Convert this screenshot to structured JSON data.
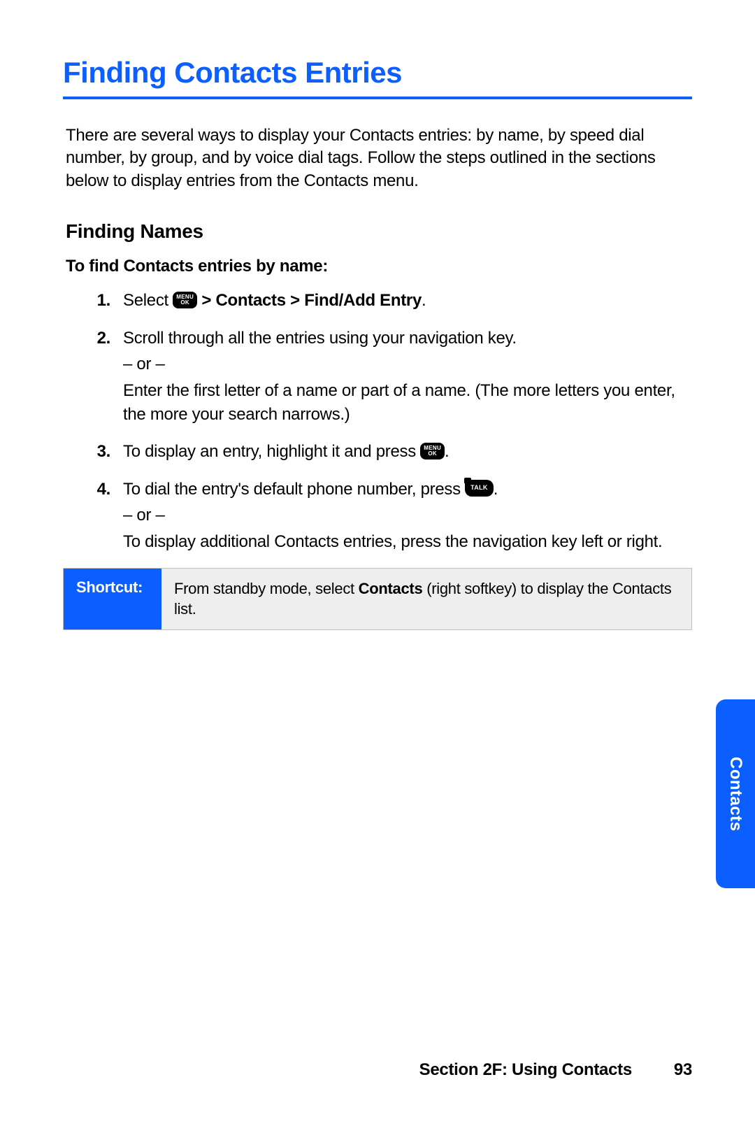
{
  "title": "Finding Contacts Entries",
  "intro": "There are several ways to display your Contacts entries: by name, by speed dial number, by group, and by voice dial tags. Follow the steps outlined in the sections below to display entries from the Contacts menu.",
  "subhead": "Finding Names",
  "lead": "To find Contacts entries by name:",
  "keys": {
    "menu_l1": "MENU",
    "menu_l2": "OK",
    "talk": "TALK"
  },
  "steps": {
    "n1": "1.",
    "s1a": "Select ",
    "s1b": " > Contacts > Find/Add Entry",
    "s1c": ".",
    "n2": "2.",
    "s2a": "Scroll through all the entries using your navigation key.",
    "s2or": "– or –",
    "s2b": "Enter the first letter of a name or part of a name. (The more letters you enter, the more your search narrows.)",
    "n3": "3.",
    "s3a": "To display an entry, highlight it and press ",
    "s3b": ".",
    "n4": "4.",
    "s4a": "To dial the entry's default phone number, press ",
    "s4b": ".",
    "s4or": "– or –",
    "s4c": "To display additional Contacts entries, press the navigation key left or right."
  },
  "shortcut": {
    "label": "Shortcut:",
    "text_a": "From standby mode, select ",
    "text_bold": "Contacts",
    "text_b": " (right softkey) to display the Contacts list."
  },
  "tab": "Contacts",
  "footer": {
    "section": "Section 2F: Using Contacts",
    "page": "93"
  }
}
